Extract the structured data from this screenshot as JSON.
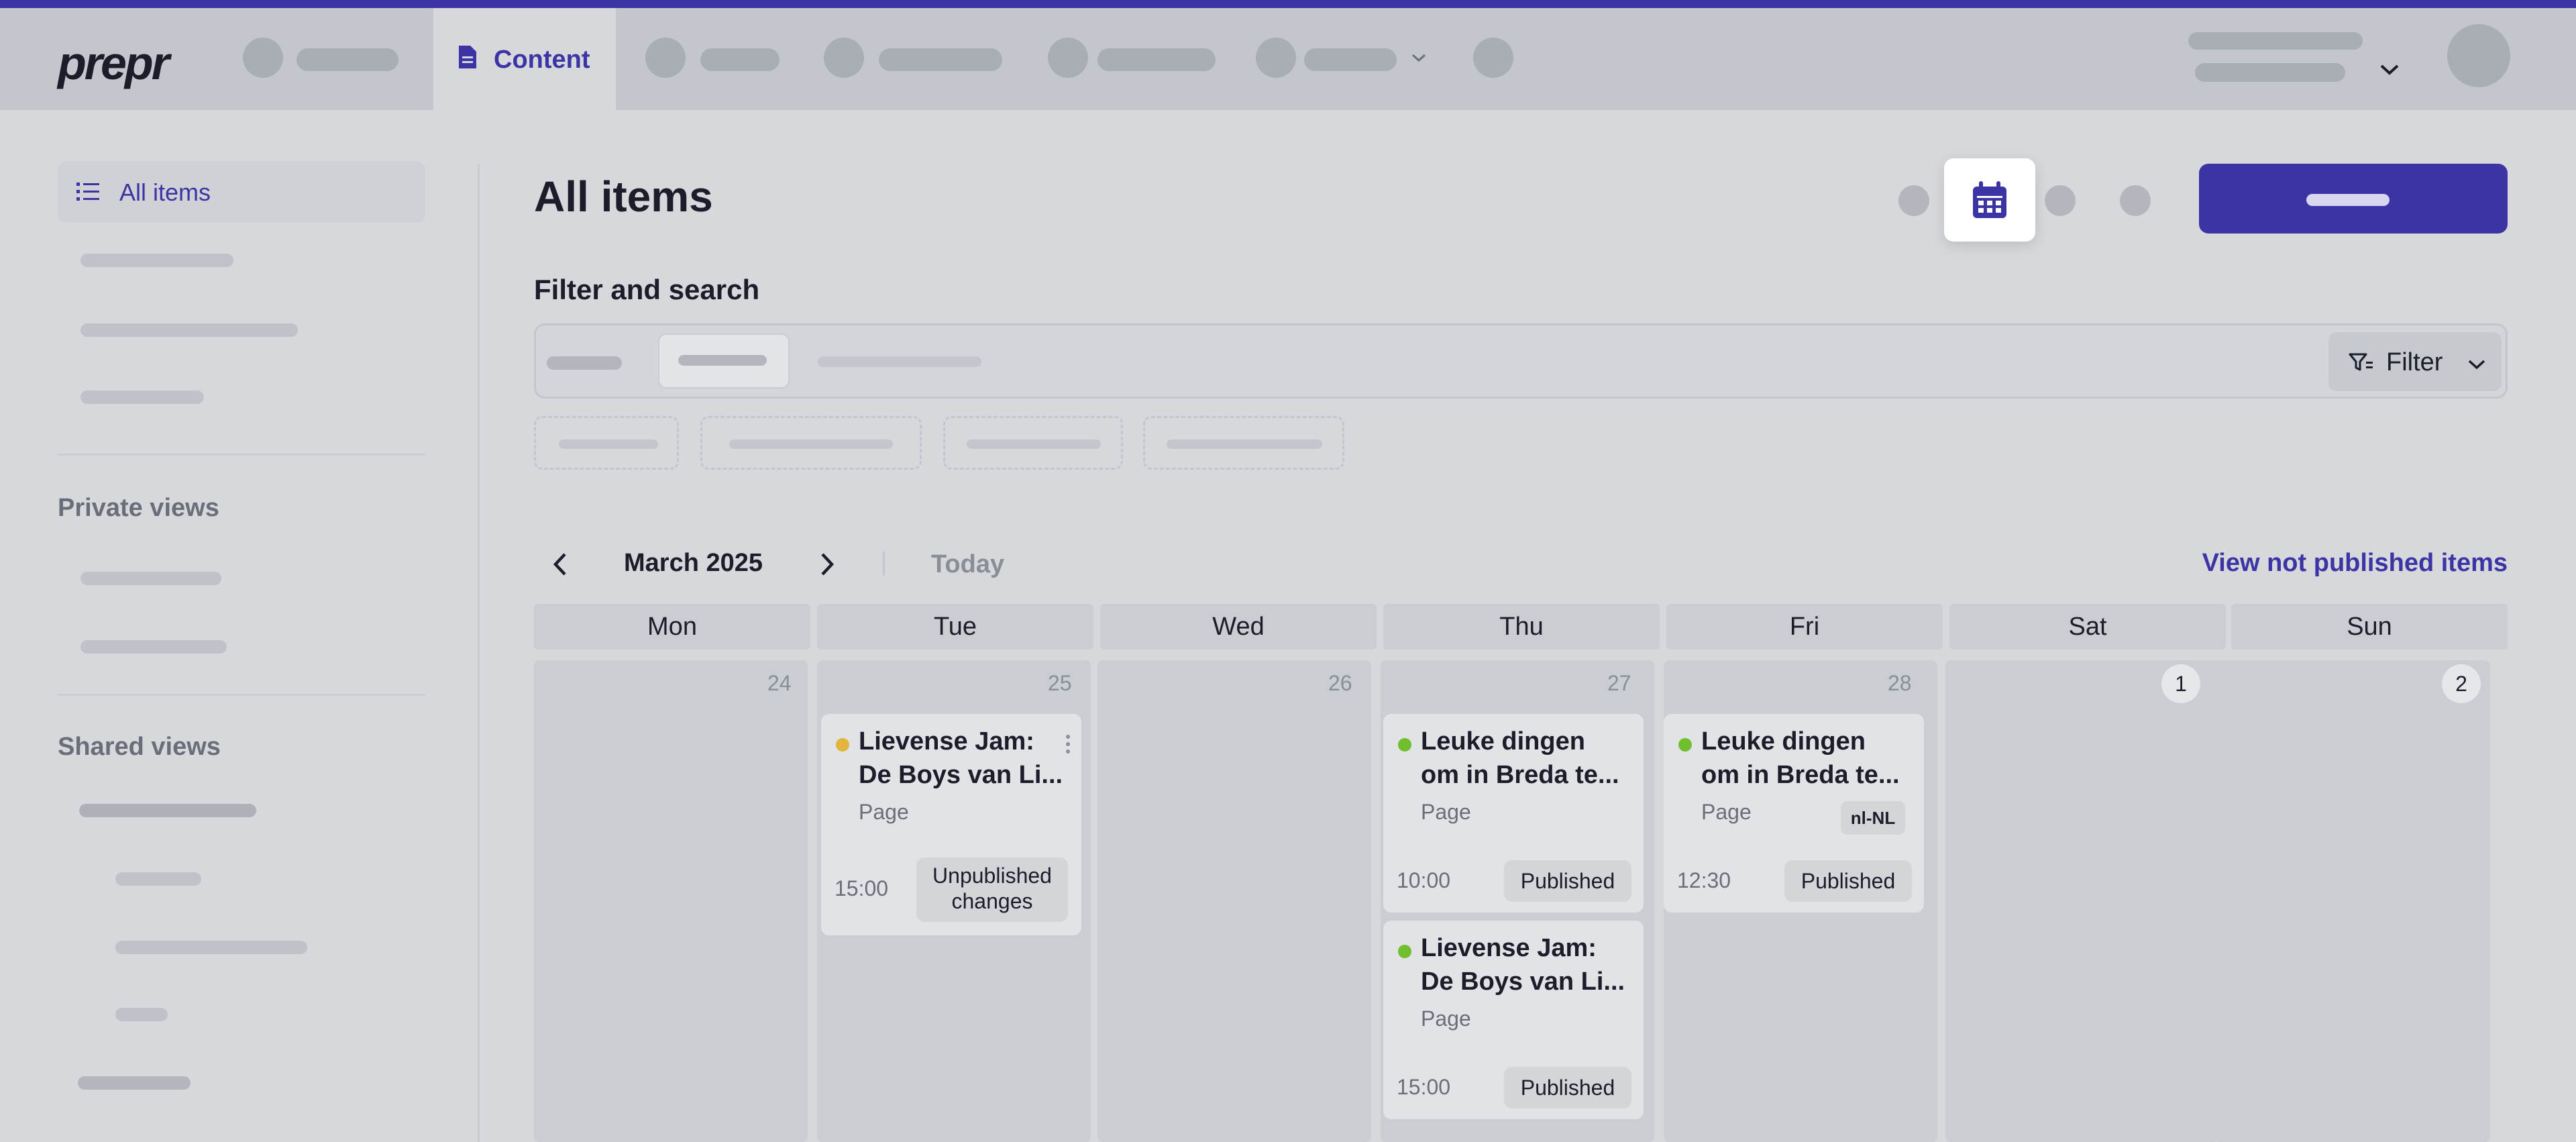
{
  "app": {
    "logo": "prepr"
  },
  "nav": {
    "active_tab": "Content"
  },
  "sidebar": {
    "active_item": "All items",
    "private_views_heading": "Private views",
    "shared_views_heading": "Shared views"
  },
  "main": {
    "title": "All items",
    "filter_heading": "Filter and search",
    "filter_button": "Filter"
  },
  "calendar": {
    "month": "March 2025",
    "today_label": "Today",
    "view_not_published": "View not published items",
    "weekdays": [
      "Mon",
      "Tue",
      "Wed",
      "Thu",
      "Fri",
      "Sat",
      "Sun"
    ],
    "dates": [
      "24",
      "25",
      "26",
      "27",
      "28",
      "1",
      "2"
    ],
    "cards": [
      {
        "title_line1": "Lievense Jam:",
        "title_line2": "De Boys van Li...",
        "type": "Page",
        "time": "15:00",
        "status": "Unpublished changes",
        "status_line1": "Unpublished",
        "status_line2": "changes",
        "dot_color": "#e3b53a",
        "locale": ""
      },
      {
        "title_line1": "Leuke dingen",
        "title_line2": "om in Breda te...",
        "type": "Page",
        "time": "10:00",
        "status": "Published",
        "dot_color": "#6fbf2f",
        "locale": ""
      },
      {
        "title_line1": "Lievense Jam:",
        "title_line2": "De Boys van Li...",
        "type": "Page",
        "time": "15:00",
        "status": "Published",
        "dot_color": "#6fbf2f",
        "locale": ""
      },
      {
        "title_line1": "Leuke dingen",
        "title_line2": "om in Breda te...",
        "type": "Page",
        "time": "12:30",
        "status": "Published",
        "dot_color": "#6fbf2f",
        "locale": "nl-NL"
      }
    ]
  },
  "colors": {
    "accent": "#3c34a4",
    "published": "#6fbf2f",
    "unpublished": "#e3b53a"
  },
  "icons": [
    "document-icon",
    "list-icon",
    "calendar-icon",
    "filter-icon",
    "chevron-down-icon",
    "chevron-left-icon",
    "chevron-right-icon",
    "more-vertical-icon"
  ]
}
